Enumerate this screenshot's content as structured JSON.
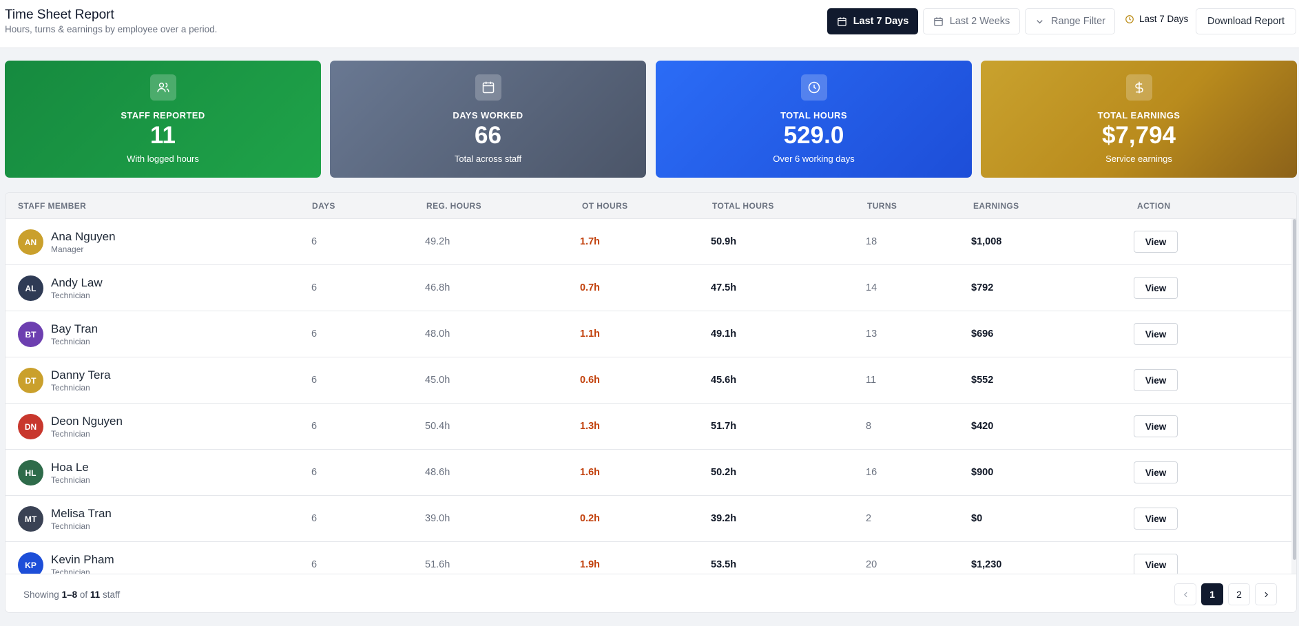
{
  "header": {
    "title": "Time Sheet Report",
    "subtitle": "Hours, turns & earnings by employee over a period.",
    "buttons": {
      "last7": "Last 7 Days",
      "last2w": "Last 2 Weeks",
      "range": "Range Filter"
    },
    "period_label": "Last 7 Days",
    "download": "Download Report"
  },
  "cards": [
    {
      "label": "STAFF REPORTED",
      "value": "11",
      "sub": "With logged hours",
      "icon": "users-icon"
    },
    {
      "label": "DAYS WORKED",
      "value": "66",
      "sub": "Total across staff",
      "icon": "calendar-icon"
    },
    {
      "label": "TOTAL HOURS",
      "value": "529.0",
      "sub": "Over 6 working days",
      "icon": "clock-icon"
    },
    {
      "label": "TOTAL EARNINGS",
      "value": "$7,794",
      "sub": "Service earnings",
      "icon": "dollar-icon"
    }
  ],
  "table": {
    "columns": {
      "staff": "STAFF MEMBER",
      "days": "DAYS",
      "reg": "REG. HOURS",
      "ot": "OT HOURS",
      "total": "TOTAL HOURS",
      "turns": "TURNS",
      "earnings": "EARNINGS",
      "action": "ACTION"
    },
    "view_label": "View",
    "rows": [
      {
        "initials": "AN",
        "name": "Ana Nguyen",
        "role": "Manager",
        "days": "6",
        "reg": "49.2h",
        "ot": "1.7h",
        "total": "50.9h",
        "turns": "18",
        "earnings": "$1,008",
        "color": "#caa02c"
      },
      {
        "initials": "AL",
        "name": "Andy Law",
        "role": "Technician",
        "days": "6",
        "reg": "46.8h",
        "ot": "0.7h",
        "total": "47.5h",
        "turns": "14",
        "earnings": "$792",
        "color": "#2f3b55"
      },
      {
        "initials": "BT",
        "name": "Bay Tran",
        "role": "Technician",
        "days": "6",
        "reg": "48.0h",
        "ot": "1.1h",
        "total": "49.1h",
        "turns": "13",
        "earnings": "$696",
        "color": "#6d3fb0"
      },
      {
        "initials": "DT",
        "name": "Danny Tera",
        "role": "Technician",
        "days": "6",
        "reg": "45.0h",
        "ot": "0.6h",
        "total": "45.6h",
        "turns": "11",
        "earnings": "$552",
        "color": "#caa02c"
      },
      {
        "initials": "DN",
        "name": "Deon Nguyen",
        "role": "Technician",
        "days": "6",
        "reg": "50.4h",
        "ot": "1.3h",
        "total": "51.7h",
        "turns": "8",
        "earnings": "$420",
        "color": "#c8372d"
      },
      {
        "initials": "HL",
        "name": "Hoa Le",
        "role": "Technician",
        "days": "6",
        "reg": "48.6h",
        "ot": "1.6h",
        "total": "50.2h",
        "turns": "16",
        "earnings": "$900",
        "color": "#2e6b4a"
      },
      {
        "initials": "MT",
        "name": "Melisa Tran",
        "role": "Technician",
        "days": "6",
        "reg": "39.0h",
        "ot": "0.2h",
        "total": "39.2h",
        "turns": "2",
        "earnings": "$0",
        "color": "#3a4254"
      },
      {
        "initials": "KP",
        "name": "Kevin Pham",
        "role": "Technician",
        "days": "6",
        "reg": "51.6h",
        "ot": "1.9h",
        "total": "53.5h",
        "turns": "20",
        "earnings": "$1,230",
        "color": "#1d4ed8"
      }
    ]
  },
  "footer": {
    "showing_prefix": "Showing",
    "showing_range": "1–8",
    "showing_of": "of",
    "showing_total": "11",
    "showing_suffix": "staff",
    "pages": [
      "1",
      "2"
    ]
  }
}
